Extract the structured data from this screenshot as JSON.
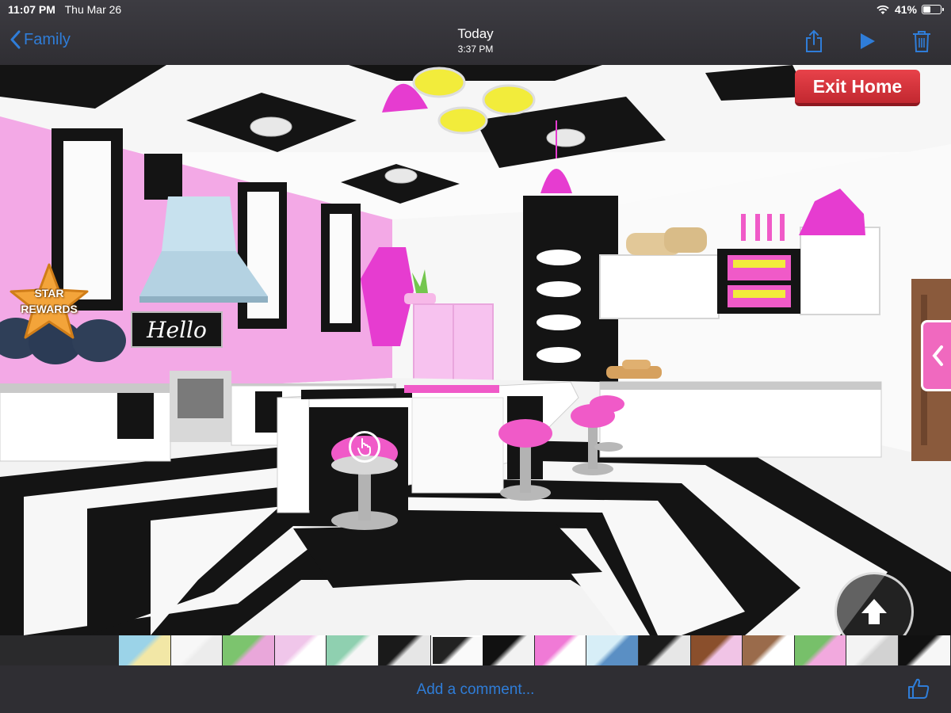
{
  "status_bar": {
    "time": "11:07 PM",
    "date": "Thu Mar 26",
    "battery": "41%",
    "battery_level": 0.41,
    "wifi_icon": "wifi-icon"
  },
  "header": {
    "back_label": "Family",
    "title": "Today",
    "subtitle": "3:37 PM",
    "icons": [
      "share-icon",
      "play-icon",
      "trash-icon"
    ]
  },
  "game": {
    "exit_button": "Exit Home",
    "star_rewards": [
      "STAR",
      "REWARDS"
    ],
    "sign_text": "Hello",
    "colors": {
      "pink": "#f05ac8",
      "wall_pink": "#f3a9e6",
      "black": "#141414",
      "exit_red": "#d8323a"
    }
  },
  "thumbnails": [
    {
      "c1": "#9bd3e8",
      "c2": "#f2e7a6"
    },
    {
      "c1": "#f7f7f7",
      "c2": "#ececec"
    },
    {
      "c1": "#7cc46e",
      "c2": "#e9a7da"
    },
    {
      "c1": "#f0c6ea",
      "c2": "#ffffff"
    },
    {
      "c1": "#8fd0b0",
      "c2": "#f6f6f6"
    },
    {
      "c1": "#1a1a1a",
      "c2": "#e6e6e6"
    },
    {
      "c1": "#222222",
      "c2": "#fafafa"
    },
    {
      "c1": "#111111",
      "c2": "#f2f2f2"
    },
    {
      "c1": "#f07ad6",
      "c2": "#ffffff"
    },
    {
      "c1": "#d7eef7",
      "c2": "#5a8fc4"
    },
    {
      "c1": "#1b1b1b",
      "c2": "#e7e7e7"
    },
    {
      "c1": "#8a4f2c",
      "c2": "#f1c4e6"
    },
    {
      "c1": "#9a6b4b",
      "c2": "#ffffff"
    },
    {
      "c1": "#77c06a",
      "c2": "#f2a9de"
    },
    {
      "c1": "#f3f3f3",
      "c2": "#d2d2d2"
    },
    {
      "c1": "#111111",
      "c2": "#f7f7f7"
    },
    {
      "c1": "#7ab9e4",
      "c2": "#d6ecf7"
    },
    {
      "c1": "#f6f6f6",
      "c2": "#cfcfcf"
    },
    {
      "c1": "#c98ee6",
      "c2": "#f5c6ee"
    },
    {
      "c1": "#bde0f3",
      "c2": "#f2f2f2"
    }
  ],
  "footer": {
    "comment_placeholder": "Add a comment...",
    "like_icon": "thumbs-up-icon"
  }
}
